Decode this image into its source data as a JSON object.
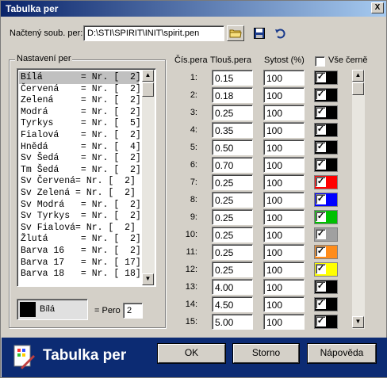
{
  "window": {
    "title": "Tabulka per",
    "close": "X"
  },
  "file": {
    "label": "Načtený soub. per:",
    "path": "D:\\STI\\SPIRIT\\INIT\\spirit.pen"
  },
  "toolbar": {
    "open_icon": "folder-icon",
    "save_icon": "floppy-icon",
    "undo_icon": "undo-icon"
  },
  "settings": {
    "title": "Nastavení per",
    "items": [
      "Bílá       = Nr. [  2]",
      "Červená    = Nr. [  2]",
      "Zelená     = Nr. [  2]",
      "Modrá      = Nr. [  2]",
      "Tyrkys     = Nr. [  5]",
      "Fialová    = Nr. [  2]",
      "Hnědá      = Nr. [  4]",
      "Sv Šedá    = Nr. [  2]",
      "Tm Šedá    = Nr. [  2]",
      "Sv Červená= Nr. [  2]",
      "Sv Zelená = Nr. [  2]",
      "Sv Modrá   = Nr. [  2]",
      "Sv Tyrkys  = Nr. [  2]",
      "Sv Fialová= Nr. [  2]",
      "Žlutá      = Nr. [  2]",
      "Barva 16   = Nr. [  2]",
      "Barva 17   = Nr. [ 17]",
      "Barva 18   = Nr. [ 18]"
    ],
    "selected_color_name": "Bílá",
    "selected_color": "#000000",
    "pero_label": "= Pero",
    "pero_value": "2"
  },
  "table": {
    "col_pen": "Čís.pera",
    "col_thickness": "Tlouš.pera",
    "col_opacity": "Sytost (%)",
    "all_black_label": "Vše černě",
    "rows": [
      {
        "n": "1:",
        "t": "0.15",
        "s": "100",
        "color": "#000000"
      },
      {
        "n": "2:",
        "t": "0.18",
        "s": "100",
        "color": "#000000"
      },
      {
        "n": "3:",
        "t": "0.25",
        "s": "100",
        "color": "#000000"
      },
      {
        "n": "4:",
        "t": "0.35",
        "s": "100",
        "color": "#000000"
      },
      {
        "n": "5:",
        "t": "0.50",
        "s": "100",
        "color": "#000000"
      },
      {
        "n": "6:",
        "t": "0.70",
        "s": "100",
        "color": "#000000"
      },
      {
        "n": "7:",
        "t": "0.25",
        "s": "100",
        "color": "#ff0000"
      },
      {
        "n": "8:",
        "t": "0.25",
        "s": "100",
        "color": "#0000ff"
      },
      {
        "n": "9:",
        "t": "0.25",
        "s": "100",
        "color": "#00c000"
      },
      {
        "n": "10:",
        "t": "0.25",
        "s": "100",
        "color": "#a0a0a0"
      },
      {
        "n": "11:",
        "t": "0.25",
        "s": "100",
        "color": "#ff8c1a"
      },
      {
        "n": "12:",
        "t": "0.25",
        "s": "100",
        "color": "#ffff00"
      },
      {
        "n": "13:",
        "t": "4.00",
        "s": "100",
        "color": "#000000"
      },
      {
        "n": "14:",
        "t": "4.50",
        "s": "100",
        "color": "#000000"
      },
      {
        "n": "15:",
        "t": "5.00",
        "s": "100",
        "color": "#000000"
      }
    ]
  },
  "footer": {
    "title": "Tabulka per",
    "ok": "OK",
    "cancel": "Storno",
    "help": "Nápověda"
  }
}
